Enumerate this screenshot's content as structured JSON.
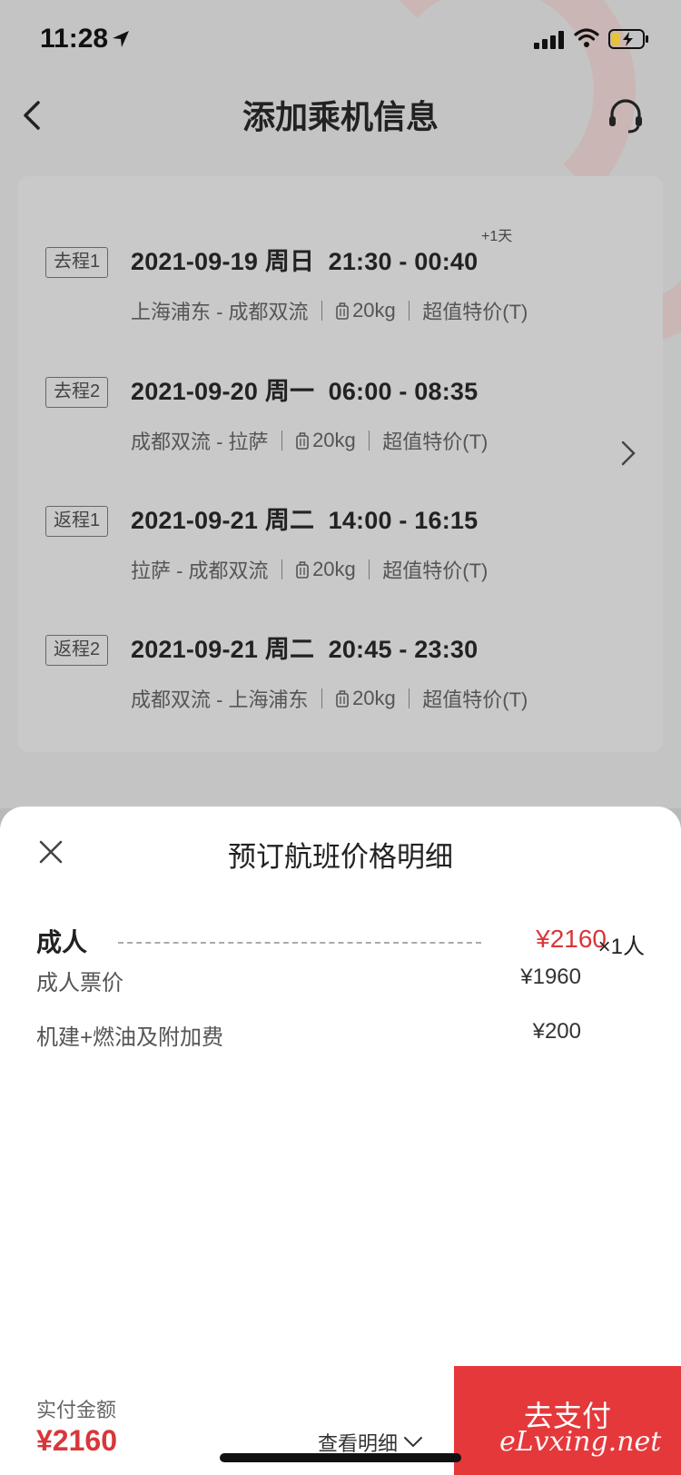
{
  "status_bar": {
    "time": "11:28"
  },
  "nav": {
    "title": "添加乘机信息"
  },
  "segments": [
    {
      "tag": "去程1",
      "main": "2021-09-19 周日  21:30 - 00:40",
      "plus_day": "+1天",
      "route": "上海浦东 - 成都双流",
      "baggage": "20kg",
      "fare": "超值特价(T)"
    },
    {
      "tag": "去程2",
      "main": "2021-09-20 周一  06:00 - 08:35",
      "route": "成都双流 - 拉萨",
      "baggage": "20kg",
      "fare": "超值特价(T)"
    },
    {
      "tag": "返程1",
      "main": "2021-09-21 周二  14:00 - 16:15",
      "route": "拉萨 - 成都双流",
      "baggage": "20kg",
      "fare": "超值特价(T)"
    },
    {
      "tag": "返程2",
      "main": "2021-09-21 周二  20:45 - 23:30",
      "route": "成都双流 - 上海浦东",
      "baggage": "20kg",
      "fare": "超值特价(T)"
    }
  ],
  "sheet": {
    "title": "预订航班价格明细",
    "adult": {
      "label": "成人",
      "price": "¥2160",
      "count": "×1人"
    },
    "fees": [
      {
        "label": "成人票价",
        "value": "¥1960"
      },
      {
        "label": "机建+燃油及附加费",
        "value": "¥200"
      }
    ]
  },
  "footer": {
    "pay_label": "实付金额",
    "pay_amount": "¥2160",
    "detail_link": "查看明细",
    "pay_button": "去支付"
  },
  "watermark": "eLvxing.net",
  "colors": {
    "accent": "#e5383b",
    "price": "#d9363a",
    "overlay": "#c4c4c4"
  }
}
